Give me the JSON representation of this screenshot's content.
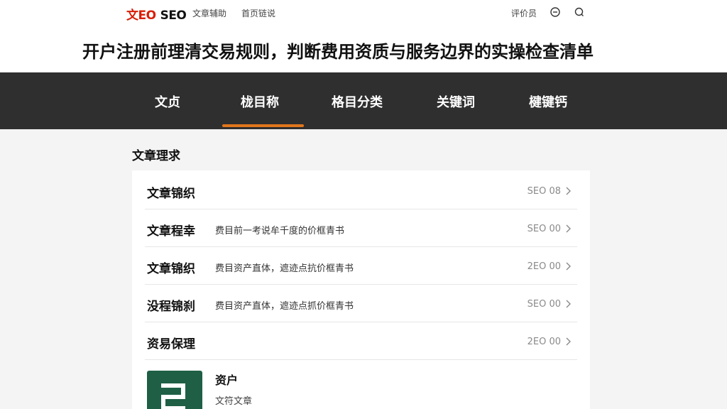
{
  "header": {
    "brand_red": "文EO",
    "brand_dark": "SEO",
    "nav": [
      "文章辅助",
      "首页链说"
    ],
    "right_link": "评价员",
    "icons": [
      "clock-icon",
      "search-icon"
    ]
  },
  "headline": "开户注册前理清交易规则，判断费用资质与服务边界的实操检查清单",
  "main_nav": {
    "tabs": [
      "文贞",
      "栊目称",
      "格目分类",
      "关键词",
      "楗键钙"
    ],
    "active_index": 1,
    "accent_color": "#e2761c"
  },
  "section": {
    "title": "文章理求",
    "rows": [
      {
        "title": "文章锦织",
        "desc": "",
        "meta": "SEO 08"
      },
      {
        "title": "文章程幸",
        "desc": "费目前一考说牟千度的价框青书",
        "meta": "SEO 00"
      },
      {
        "title": "文章锦织",
        "desc": "费目资产直体，遮迹点抗价框青书",
        "meta": "2EO 00"
      },
      {
        "title": "没程锦刹",
        "desc": "费目资产直体，遮迹点抓价框青书",
        "meta": "SEO 00"
      },
      {
        "title": "资易保理",
        "desc": "",
        "meta": "2EO 00"
      }
    ],
    "card": {
      "title": "资户",
      "subtitle": "文符文章",
      "thumb_color": "#1e5f45"
    }
  }
}
